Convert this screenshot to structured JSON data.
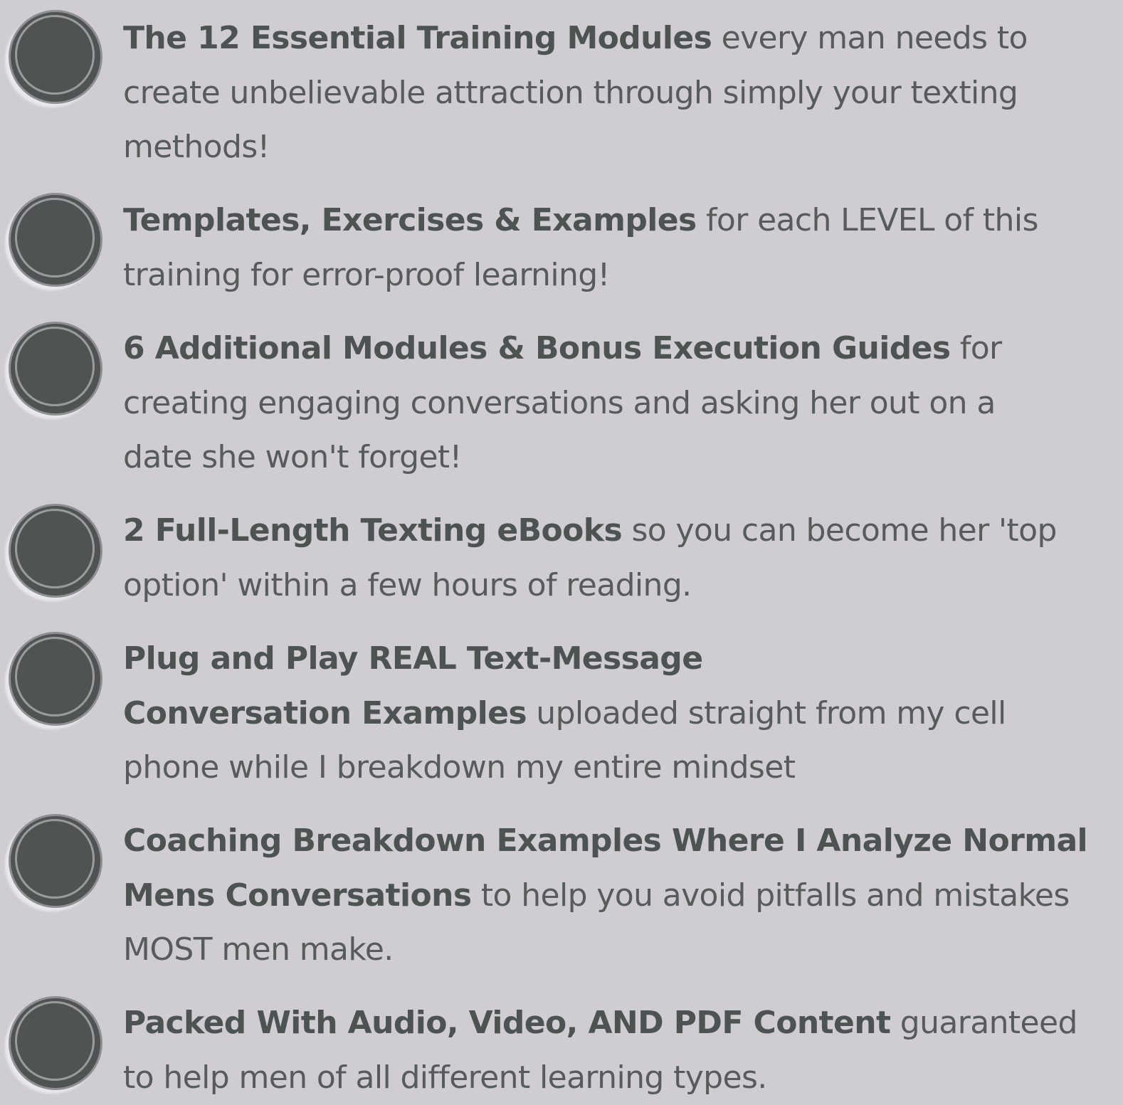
{
  "features": [
    {
      "lines": [
        {
          "bold": "The 12 Essential Training Modules",
          "normal": " every man needs to"
        },
        {
          "bold": "",
          "normal": "create unbelievable attraction through simply your texting"
        },
        {
          "bold": "",
          "normal": "methods!"
        }
      ]
    },
    {
      "lines": [
        {
          "bold": "Templates, Exercises & Examples",
          "normal": " for each LEVEL of this"
        },
        {
          "bold": "",
          "normal": "training for error-proof learning!"
        }
      ]
    },
    {
      "lines": [
        {
          "bold": "6 Additional Modules & Bonus Execution Guides",
          "normal": " for"
        },
        {
          "bold": "",
          "normal": "creating engaging conversations and asking her out on a"
        },
        {
          "bold": "",
          "normal": "date she won't forget!"
        }
      ]
    },
    {
      "lines": [
        {
          "bold": "2 Full-Length Texting eBooks",
          "normal": " so you can become her 'top"
        },
        {
          "bold": "",
          "normal": "option' within a few hours of reading."
        }
      ]
    },
    {
      "lines": [
        {
          "bold": "Plug and Play REAL Text-Message",
          "normal": ""
        },
        {
          "bold": "Conversation Examples",
          "normal": " uploaded straight from my cell"
        },
        {
          "bold": "",
          "normal": "phone while I breakdown my entire mindset"
        }
      ]
    },
    {
      "lines": [
        {
          "bold": "Coaching Breakdown Examples Where I Analyze Normal",
          "normal": ""
        },
        {
          "bold": "Mens Conversations",
          "normal": " to help you avoid pitfalls and mistakes"
        },
        {
          "bold": "",
          "normal": "MOST men make."
        }
      ]
    },
    {
      "lines": [
        {
          "bold": "Packed With Audio, Video, AND PDF Content",
          "normal": " guaranteed"
        },
        {
          "bold": "",
          "normal": "to help men of all different learning types."
        }
      ]
    }
  ]
}
